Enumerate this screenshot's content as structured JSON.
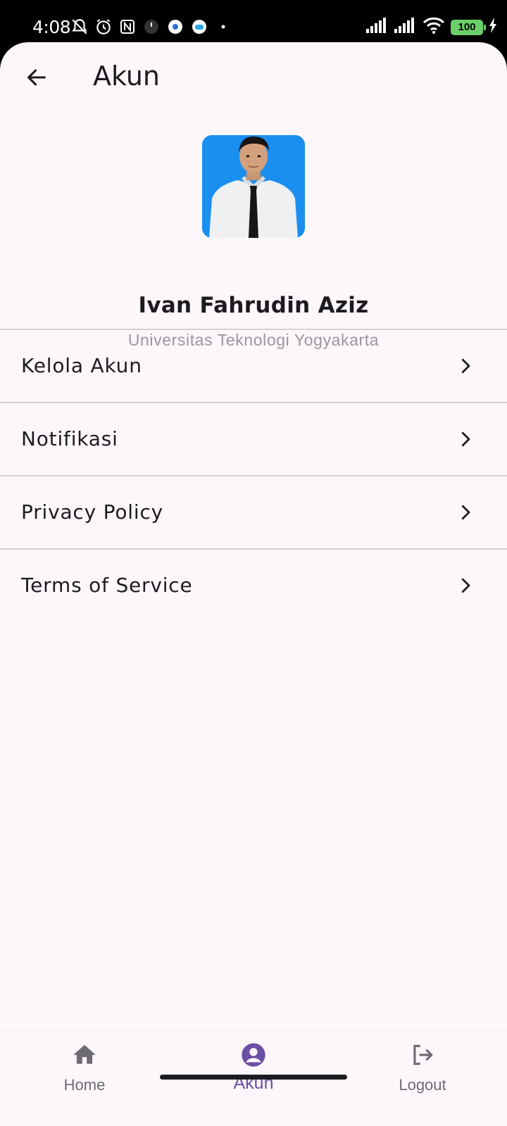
{
  "status_bar": {
    "time": "4:08",
    "battery": "100",
    "icons_left": [
      "bell-off-icon",
      "alarm-icon",
      "nfc-icon",
      "clock-app-icon",
      "settings-app-icon",
      "game-app-icon",
      "dot-icon"
    ],
    "icons_right": [
      "signal-icon",
      "signal-icon",
      "wifi-icon",
      "battery-icon",
      "charging-icon"
    ]
  },
  "app_bar": {
    "title": "Akun",
    "back_icon": "arrow-left-icon"
  },
  "profile": {
    "name": "Ivan Fahrudin Aziz",
    "institution": "Universitas Teknologi Yogyakarta",
    "avatar_background": "#1a8ff0"
  },
  "menu": {
    "items": [
      {
        "label": "Kelola Akun"
      },
      {
        "label": "Notifikasi"
      },
      {
        "label": "Privacy Policy"
      },
      {
        "label": "Terms of Service"
      }
    ]
  },
  "bottom_nav": {
    "items": [
      {
        "label": "Home",
        "icon": "home-icon",
        "active": false
      },
      {
        "label": "Akun",
        "icon": "account-circle-icon",
        "active": true
      },
      {
        "label": "Logout",
        "icon": "logout-icon",
        "active": false
      }
    ]
  },
  "colors": {
    "background": "#fdf7fc",
    "accent": "#6a4fa2",
    "text_primary": "#1d1b20",
    "text_secondary": "#9a969d",
    "divider": "#d5d1d7"
  }
}
